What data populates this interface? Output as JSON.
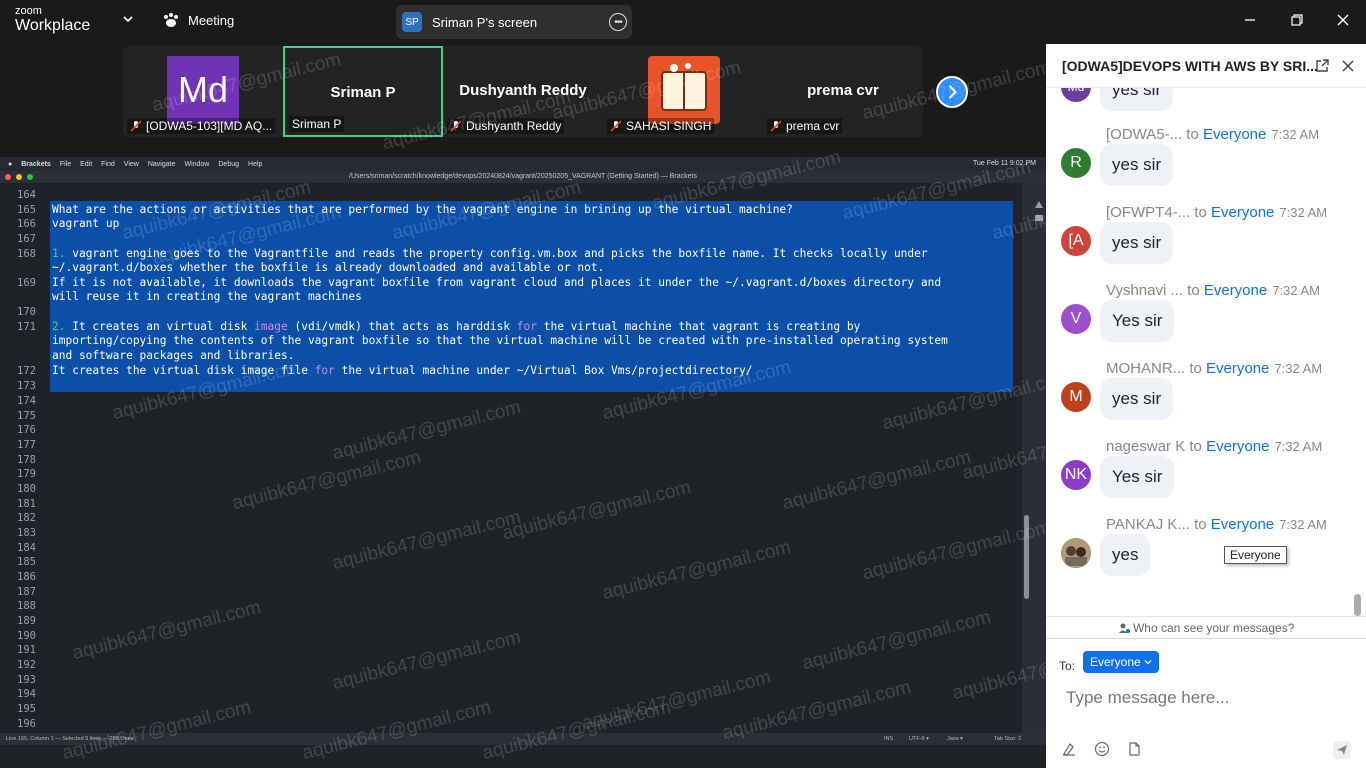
{
  "topbar": {
    "logo_line1": "zoom",
    "logo_line2": "Workplace",
    "meeting_label": "Meeting",
    "screen_initials": "SP",
    "screen_label": "Sriman P's screen",
    "more_glyph": "•••"
  },
  "participants": [
    {
      "name": "",
      "label": "[ODWA5-103][MD AQ...",
      "avatar": "Md",
      "active": false
    },
    {
      "name": "Sriman P",
      "label": "Sriman P",
      "active": true
    },
    {
      "name": "Dushyanth Reddy",
      "label": "Dushyanth Reddy",
      "active": false
    },
    {
      "name": "",
      "label": "SAHASI SINGH",
      "active": false
    },
    {
      "name": "prema cvr",
      "label": "prema cvr",
      "active": false
    }
  ],
  "editor": {
    "menu_apple": "",
    "menu_items": [
      "Brackets",
      "File",
      "Edit",
      "Find",
      "View",
      "Navigate",
      "Window",
      "Debug",
      "Help"
    ],
    "clock": "Tue Feb 11  9:02 PM",
    "window_title": "/Users/sriman/scratch/knowledge/devops/20240824/vagrant/20250205_VAGRANT (Getting Started) — Brackets",
    "line_numbers": [
      "164",
      "165",
      "166",
      "167",
      "168",
      "",
      "169",
      "",
      "170",
      "171",
      "",
      "",
      "172",
      "173",
      "174",
      "175",
      "176",
      "177",
      "178",
      "179",
      "180",
      "181",
      "182",
      "183",
      "184",
      "185",
      "186",
      "187",
      "188",
      "189",
      "190",
      "191",
      "192",
      "193",
      "194",
      "195",
      "196"
    ],
    "code": {
      "l165": "What are the actions or activities that are performed by the vagrant engine in brining up the virtual machine?",
      "l166": "vagrant up",
      "l168_num": "1.",
      "l168a": " vagrant engine goes to the Vagrantfile and reads the property config.vm.box and picks the boxfile name. It checks locally under",
      "l168b": "~/.vagrant.d/boxes whether the boxfile is already downloaded and available or not.",
      "l169a": "If it is not available, it downloads the vagrant boxfile from vagrant cloud and places it under the ~/.vagrant.d/boxes directory and",
      "l169b": "will reuse it in creating the vagrant machines",
      "l171_num": "2.",
      "l171a_1": " It creates an virtual disk ",
      "l171a_kw": "image",
      "l171a_2": " (vdi/vmdk) that acts as harddisk ",
      "l171a_kw2": "for",
      "l171a_3": " the virtual machine that vagrant is creating by",
      "l171b": "importing/copying the contents of the vagrant boxfile so that the virtual machine will be created with pre-installed operating system",
      "l171c": "and software packages and libraries.",
      "l172_1": "It creates the virtual disk image file ",
      "l172_kw": "for",
      "l172_2": " the virtual machine under ~/Virtual Box Vms/projectdirectory/"
    },
    "status_left": "Line 165, Column 1 — Selected 9 lines — 288 Lines",
    "status_ins": "INS",
    "status_enc": "UTF-8 ▾",
    "status_lang": "Java ▾",
    "status_tab": "Tab Size: 2"
  },
  "watermark": "aquibk647@gmail.com",
  "chat": {
    "title": "[ODWA5]DEVOPS WITH AWS BY SRI...",
    "messages": [
      {
        "sender": "",
        "to": "",
        "everyone": "",
        "time": "",
        "text": "yes sir",
        "initials": "Md",
        "color": "#6b3fa0"
      },
      {
        "sender": "[ODWA5-...",
        "to": "to",
        "everyone": "Everyone",
        "time": "7:32 AM",
        "text": "yes sir",
        "initials": "R",
        "color": "#2e7d32"
      },
      {
        "sender": "[OFWPT4-...",
        "to": "to",
        "everyone": "Everyone",
        "time": "7:32 AM",
        "text": "yes sir",
        "initials": "[A",
        "color": "#d0433a"
      },
      {
        "sender": "Vyshnavi ...",
        "to": "to",
        "everyone": "Everyone",
        "time": "7:32 AM",
        "text": "Yes sir",
        "initials": "V",
        "color": "#9c4fcf"
      },
      {
        "sender": "MOHANR...",
        "to": "to",
        "everyone": "Everyone",
        "time": "7:32 AM",
        "text": "yes sir",
        "initials": "M",
        "color": "#c0401c"
      },
      {
        "sender": "nageswar K",
        "to": "to",
        "everyone": "Everyone",
        "time": "7:32 AM",
        "text": "Yes sir",
        "initials": "NK",
        "color": "#8e3cc8"
      },
      {
        "sender": "PANKAJ K...",
        "to": "to",
        "everyone": "Everyone",
        "time": "7:32 AM",
        "text": "yes",
        "initials": "",
        "color": "#8a6a4e"
      }
    ],
    "tooltip": "Everyone",
    "who_can_see": "Who can see your messages?",
    "to_label": "To:",
    "to_value": "Everyone",
    "input_placeholder": "Type message here..."
  },
  "colors": {
    "accent": "#0e71eb",
    "active_tile": "#3ed28a",
    "selection": "#0b4fa8"
  }
}
